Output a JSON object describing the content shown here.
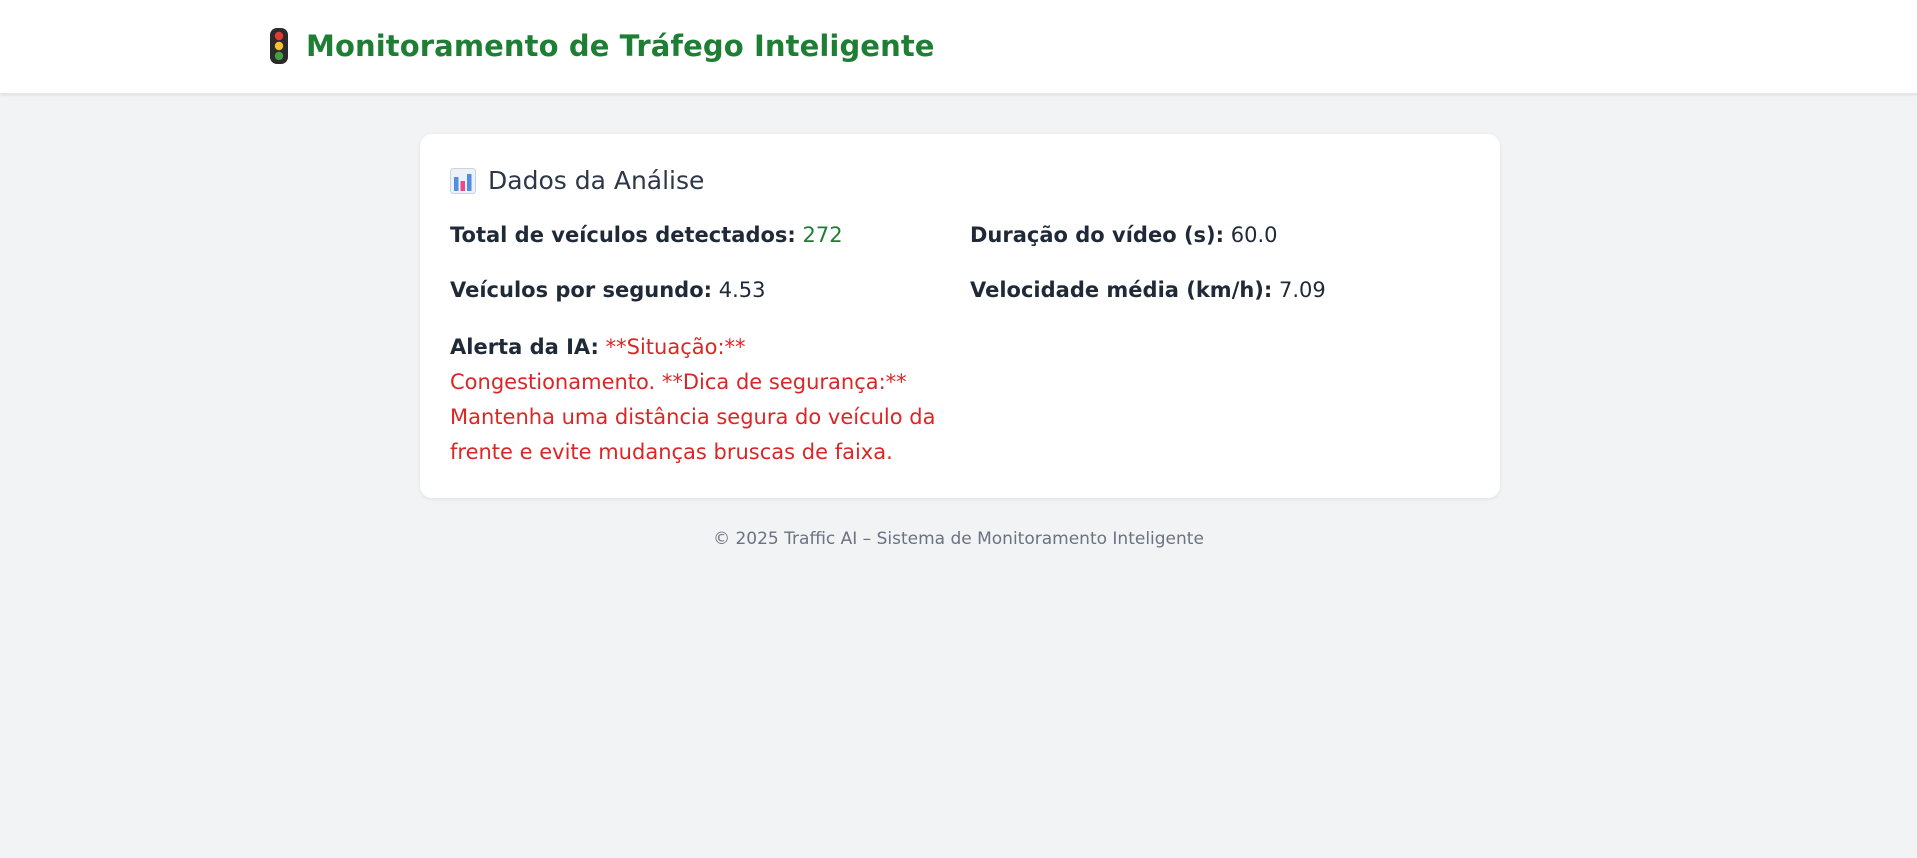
{
  "header": {
    "title": "Monitoramento de Tráfego Inteligente",
    "icon": "traffic-light-icon",
    "title_color": "#1e7e34"
  },
  "card": {
    "title": "Dados da Análise",
    "icon": "bar-chart-icon",
    "stats": {
      "total_vehicles_label": "Total de veículos detectados:",
      "total_vehicles_value": "272",
      "video_duration_label": "Duração do vídeo (s):",
      "video_duration_value": "60.0",
      "vehicles_per_second_label": "Veículos por segundo:",
      "vehicles_per_second_value": "4.53",
      "avg_speed_label": "Velocidade média (km/h):",
      "avg_speed_value": "7.09"
    },
    "alert": {
      "label": "Alerta da IA:",
      "message": "**Situação:** Congestionamento. **Dica de segurança:** Mantenha uma distância segura do veículo da frente e evite mudanças bruscas de faixa.",
      "color": "#dc2626"
    }
  },
  "footer": {
    "text": "© 2025 Traffic AI – Sistema de Monitoramento Inteligente"
  }
}
